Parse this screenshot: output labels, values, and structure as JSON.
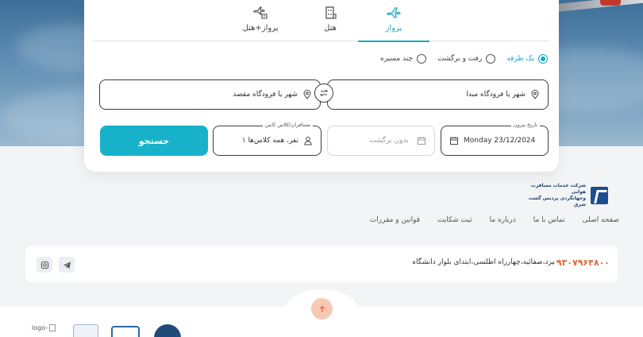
{
  "tabs": [
    {
      "label": "پرواز",
      "icon": "airplane-icon",
      "active": true
    },
    {
      "label": "هتل",
      "icon": "hotel-icon",
      "active": false
    },
    {
      "label": "پرواز+هتل",
      "icon": "flight-hotel-icon",
      "active": false
    }
  ],
  "trip_type": {
    "options": [
      "یک طرفه",
      "رفت و برگشت",
      "چند مسیره"
    ],
    "selected": "یک طرفه"
  },
  "route": {
    "origin_placeholder": "شهر یا فرودگاه مبدا",
    "destination_placeholder": "شهر یا فرودگاه مقصد"
  },
  "dates": {
    "depart_label": "تاریخ بیرون",
    "depart_value": "Monday 23/12/2024",
    "return_value": "بدون برگشت"
  },
  "passengers": {
    "label": "مسافران/کلاس کابین",
    "value": "۱ نفر، همه کلاس‌ها"
  },
  "search_button": "جستجو",
  "brand": {
    "line1": "شرکت خدمات مسافرت هوایی",
    "line2": "وجهانگردی پردیس گشت شرق"
  },
  "footer_nav": [
    "صفحه اصلی",
    "تماس با ما",
    "درباره ما",
    "ثبت شکایت",
    "قوانین و مقررات"
  ],
  "contact": {
    "phone": "۰۹۳۰۷۹۶۴۸۰۰",
    "address": "یزد،صفائیه،چهارراه اطلسی،ابتدای بلوار دانشگاه"
  },
  "footer_logos": {
    "broken_alt": "logo-"
  },
  "colors": {
    "accent": "#17a9c4",
    "button": "#17b2c9",
    "phone": "#e0683a",
    "scroll_top": "#f7c9b4"
  }
}
